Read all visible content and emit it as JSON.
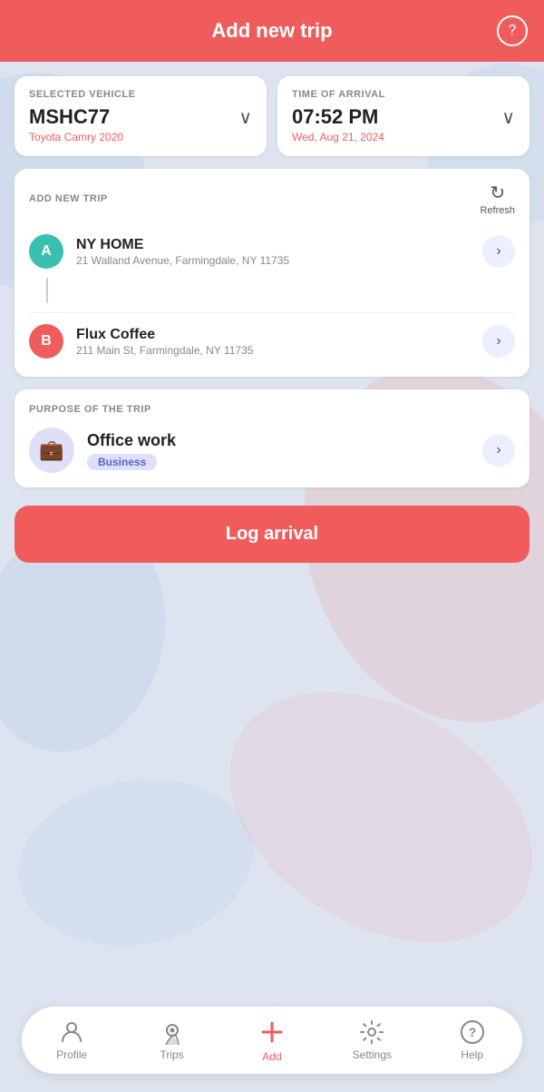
{
  "header": {
    "title": "Add new trip",
    "help_icon": "?"
  },
  "vehicle_card": {
    "label": "SELECTED VEHICLE",
    "value": "MSHC77",
    "sub": "Toyota Camry 2020",
    "chevron": "∨"
  },
  "arrival_card": {
    "label": "TIME OF ARRIVAL",
    "value": "07:52 PM",
    "sub": "Wed, Aug 21, 2024",
    "chevron": "∨"
  },
  "trip_section": {
    "label": "ADD NEW TRIP",
    "refresh_label": "Refresh",
    "origin": {
      "circle": "A",
      "name": "NY HOME",
      "address": "21 Walland Avenue, Farmingdale,  NY 11735"
    },
    "destination": {
      "circle": "B",
      "name": "Flux Coffee",
      "address": "211 Main St, Farmingdale,  NY 11735"
    }
  },
  "purpose_section": {
    "label": "PURPOSE OF THE TRIP",
    "icon": "💼",
    "name": "Office work",
    "badge": "Business"
  },
  "log_btn": {
    "label": "Log arrival"
  },
  "nav": {
    "items": [
      {
        "id": "profile",
        "label": "Profile",
        "icon": "👤",
        "active": false
      },
      {
        "id": "trips",
        "label": "Trips",
        "icon": "📍",
        "active": false
      },
      {
        "id": "add",
        "label": "Add",
        "icon": "➕",
        "active": true
      },
      {
        "id": "settings",
        "label": "Settings",
        "icon": "⚙️",
        "active": false
      },
      {
        "id": "help",
        "label": "Help",
        "icon": "❓",
        "active": false
      }
    ]
  }
}
